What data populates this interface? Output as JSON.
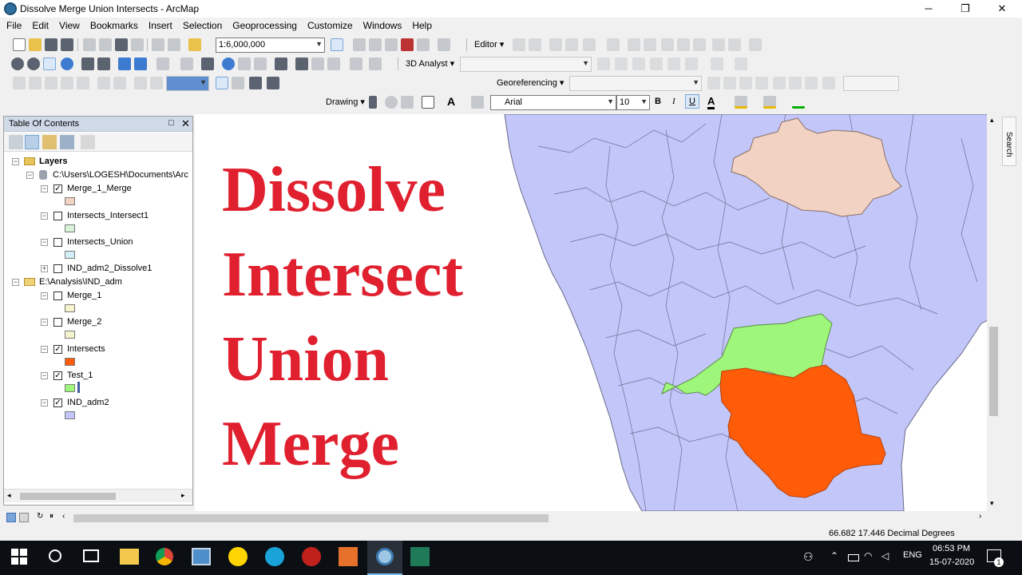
{
  "window": {
    "title": "Dissolve Merge Union Intersects - ArcMap",
    "minimize": "─",
    "maximize": "❐",
    "close": "✕"
  },
  "menu": [
    "File",
    "Edit",
    "View",
    "Bookmarks",
    "Insert",
    "Selection",
    "Geoprocessing",
    "Customize",
    "Windows",
    "Help"
  ],
  "toolbars": {
    "scale": "1:6,000,000",
    "editor": "Editor",
    "analyst3d": "3D Analyst",
    "georeferencing": "Georeferencing",
    "drawing": "Drawing",
    "font": "Arial",
    "font_size": "10",
    "bold": "B",
    "italic": "I",
    "underline": "U",
    "text_tool": "A"
  },
  "toc": {
    "title": "Table Of Contents",
    "pin": "□",
    "close": "✕",
    "root": "Layers",
    "groups": [
      {
        "label": "C:\\Users\\LOGESH\\Documents\\Arc",
        "layers": [
          {
            "label": "Merge_1_Merge",
            "checked": true,
            "color": "#f2d2c2"
          },
          {
            "label": "Intersects_Intersect1",
            "checked": false,
            "color": "#d8f2d8"
          },
          {
            "label": "Intersects_Union",
            "checked": false,
            "color": "#d2eef6"
          },
          {
            "label": "IND_adm2_Dissolve1",
            "checked": false,
            "color": null
          }
        ]
      },
      {
        "label": "E:\\Analysis\\IND_adm",
        "layers": [
          {
            "label": "Merge_1",
            "checked": false,
            "color": "#f6f4cc"
          },
          {
            "label": "Merge_2",
            "checked": false,
            "color": "#f6f4cc"
          },
          {
            "label": "Intersects",
            "checked": true,
            "color": "#ff5c0a"
          },
          {
            "label": "Test_1",
            "checked": true,
            "color": "#9ef77a"
          },
          {
            "label": "IND_adm2",
            "checked": true,
            "color": "#c2c6f8"
          }
        ]
      }
    ],
    "check_mark": "✓",
    "expand_minus": "−",
    "expand_plus": "+"
  },
  "map": {
    "overlay_lines": [
      "Dissolve",
      "Intersect",
      "Union",
      "Merge"
    ],
    "colors": {
      "base": "#c2c6f8",
      "merge": "#f2d2c2",
      "test": "#9ef77a",
      "intersects": "#ff5c0a",
      "overlay_text": "#e0202e"
    },
    "search_tab": "Search"
  },
  "status": {
    "coords": "66.682  17.446 Decimal Degrees"
  },
  "taskbar": {
    "lang": "ENG",
    "time": "06:53 PM",
    "date": "15-07-2020",
    "notifications": "1"
  }
}
